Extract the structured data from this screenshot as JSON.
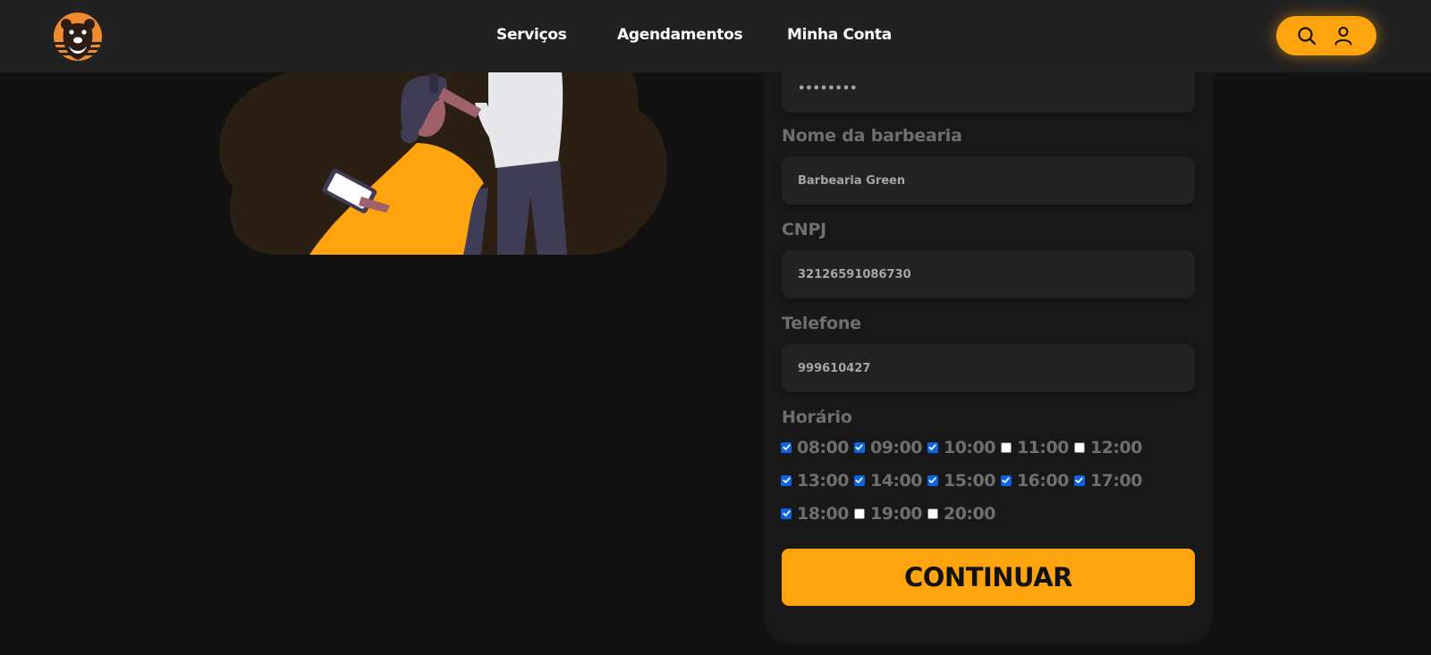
{
  "nav": {
    "links": [
      "Serviços",
      "Agendamentos",
      "Minha Conta"
    ]
  },
  "icons": {
    "logo": "bear-logo-icon",
    "search": "search-icon",
    "account": "user-icon"
  },
  "colors": {
    "accent": "#ffa30f",
    "background": "#121212",
    "header": "#212121",
    "card": "#181818",
    "input": "#222222",
    "checkbox_checked": "#0b63e5"
  },
  "form": {
    "password_value": "••••••••",
    "barbershop_label": "Nome da barbearia",
    "barbershop_value": "Barbearia Green",
    "cnpj_label": "CNPJ",
    "cnpj_value": "32126591086730",
    "phone_label": "Telefone",
    "phone_value": "999610427",
    "hours_label": "Horário",
    "hours": [
      {
        "time": "08:00",
        "checked": true
      },
      {
        "time": "09:00",
        "checked": true
      },
      {
        "time": "10:00",
        "checked": true
      },
      {
        "time": "11:00",
        "checked": false
      },
      {
        "time": "12:00",
        "checked": false
      },
      {
        "time": "13:00",
        "checked": true
      },
      {
        "time": "14:00",
        "checked": true
      },
      {
        "time": "15:00",
        "checked": true
      },
      {
        "time": "16:00",
        "checked": true
      },
      {
        "time": "17:00",
        "checked": true
      },
      {
        "time": "18:00",
        "checked": true
      },
      {
        "time": "19:00",
        "checked": false
      },
      {
        "time": "20:00",
        "checked": false
      }
    ],
    "submit_label": "CONTINUAR"
  }
}
